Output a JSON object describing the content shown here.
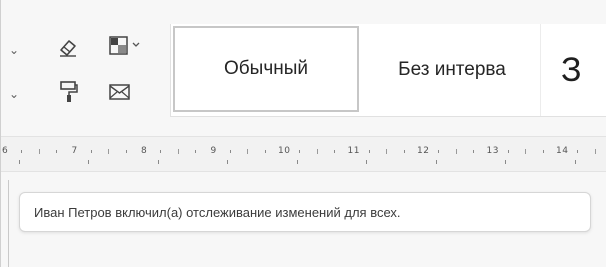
{
  "ribbon": {
    "tools": [
      {
        "name": "eraser-icon"
      },
      {
        "name": "shading-icon"
      },
      {
        "name": "format-painter-icon"
      },
      {
        "name": "envelope-icon"
      }
    ],
    "styles": [
      {
        "label": "Обычный",
        "selected": true
      },
      {
        "label": "Без интерва",
        "selected": false
      },
      {
        "label": "З",
        "selected": false
      }
    ]
  },
  "ruler": {
    "numbers": [
      "6",
      "7",
      "8",
      "9",
      "10",
      "11",
      "12",
      "13",
      "14"
    ]
  },
  "notification": {
    "message": "Иван Петров включил(а) отслеживание изменений для всех."
  }
}
